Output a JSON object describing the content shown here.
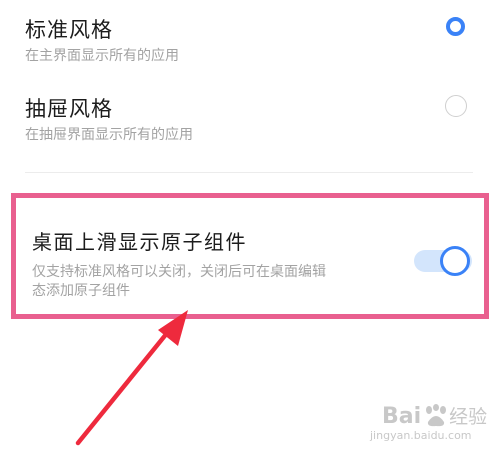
{
  "options": [
    {
      "title": "标准风格",
      "description": "在主界面显示所有的应用",
      "selected": true
    },
    {
      "title": "抽屉风格",
      "description": "在抽屉界面显示所有的应用",
      "selected": false
    }
  ],
  "setting": {
    "title": "桌面上滑显示原子组件",
    "description_line1": "仅支持标准风格可以关闭，关闭后可在桌面编辑",
    "description_line2": "态添加原子组件",
    "enabled": true
  },
  "colors": {
    "accent": "#3a82f7",
    "highlight_border": "#e9608f",
    "arrow": "#ee2a3d"
  },
  "watermark": {
    "brand_a": "Bai",
    "brand_b": "经验",
    "url": "jingyan.baidu.com"
  }
}
